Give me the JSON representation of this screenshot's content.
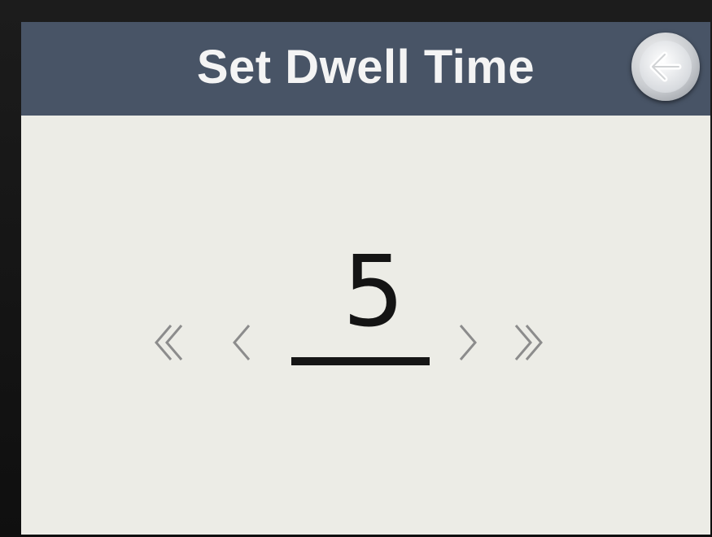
{
  "screen": {
    "title": "Set Dwell Time",
    "back_icon": "arrow-left-icon"
  },
  "editor": {
    "value": "5",
    "controls": [
      {
        "name": "fast-decrease",
        "icon": "double-chevron-left-icon"
      },
      {
        "name": "decrease",
        "icon": "chevron-left-icon"
      },
      {
        "name": "increase",
        "icon": "chevron-right-icon"
      },
      {
        "name": "fast-increase",
        "icon": "double-chevron-right-icon"
      }
    ]
  },
  "colors": {
    "title_bar": "#485466",
    "screen_background": "#ecece6",
    "title_text": "#f4f4f4",
    "value_text": "#141414",
    "chevron": "#8c8c8c"
  }
}
